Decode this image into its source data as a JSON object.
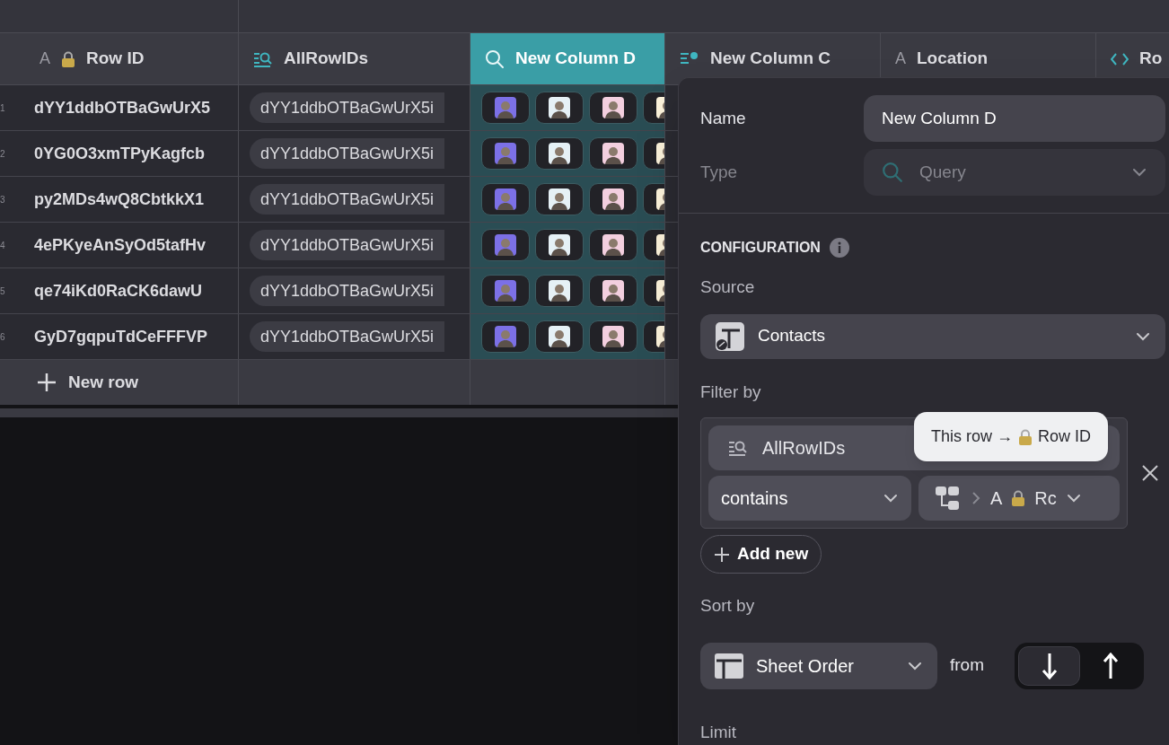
{
  "columns": [
    {
      "icon_text": "A",
      "locked": true,
      "label": "Row ID",
      "kind": "text",
      "selected": false
    },
    {
      "locked": false,
      "label": "AllRowIDs",
      "kind": "query-list",
      "selected": false
    },
    {
      "locked": false,
      "label": "New Column D",
      "kind": "query",
      "selected": true
    },
    {
      "locked": false,
      "label": "New Column C",
      "kind": "person-list",
      "selected": false
    },
    {
      "icon_text": "A",
      "locked": false,
      "label": "Location",
      "kind": "text",
      "selected": false
    },
    {
      "locked": false,
      "label": "Ro",
      "kind": "code",
      "selected": false
    }
  ],
  "rows": [
    {
      "number": "1",
      "row_id": "dYY1ddbOTBaGwUrX5",
      "all_row_ids": "dYY1ddbOTBaGwUrX5i",
      "avatars": [
        {
          "color": "#7c70e6"
        },
        {
          "color": "#e6f1f6"
        },
        {
          "color": "#f3cfdf"
        },
        {
          "color": "#fbf2da"
        }
      ]
    },
    {
      "number": "2",
      "row_id": "0YG0O3xmTPyKagfcb",
      "all_row_ids": "dYY1ddbOTBaGwUrX5i",
      "avatars": [
        {
          "color": "#7c70e6"
        },
        {
          "color": "#e6f1f6"
        },
        {
          "color": "#f3cfdf"
        },
        {
          "color": "#fbf2da"
        }
      ]
    },
    {
      "number": "3",
      "row_id": "py2MDs4wQ8CbtkkX1",
      "all_row_ids": "dYY1ddbOTBaGwUrX5i",
      "avatars": [
        {
          "color": "#7c70e6"
        },
        {
          "color": "#e6f1f6"
        },
        {
          "color": "#f3cfdf"
        },
        {
          "color": "#fbf2da"
        }
      ]
    },
    {
      "number": "4",
      "row_id": "4ePKyeAnSyOd5tafHv",
      "all_row_ids": "dYY1ddbOTBaGwUrX5i",
      "avatars": [
        {
          "color": "#7c70e6"
        },
        {
          "color": "#e6f1f6"
        },
        {
          "color": "#f3cfdf"
        },
        {
          "color": "#fbf2da"
        }
      ]
    },
    {
      "number": "5",
      "row_id": "qe74iKd0RaCK6dawU",
      "all_row_ids": "dYY1ddbOTBaGwUrX5i",
      "avatars": [
        {
          "color": "#7c70e6"
        },
        {
          "color": "#e6f1f6"
        },
        {
          "color": "#f3cfdf"
        },
        {
          "color": "#fbf2da"
        }
      ]
    },
    {
      "number": "6",
      "row_id": "GyD7gqpuTdCeFFFVP",
      "all_row_ids": "dYY1ddbOTBaGwUrX5i",
      "avatars": [
        {
          "color": "#7c70e6"
        },
        {
          "color": "#e6f1f6"
        },
        {
          "color": "#f3cfdf"
        },
        {
          "color": "#fbf2da"
        }
      ]
    }
  ],
  "new_row": "New row",
  "panel": {
    "name_label": "Name",
    "name_value": "New Column D",
    "type_label": "Type",
    "type_value": "Query",
    "type_disabled": true,
    "section_title": "CONFIGURATION",
    "source_label": "Source",
    "source_value": "Contacts",
    "filter_label": "Filter by",
    "filter": {
      "column": "AllRowIDs",
      "operator": "contains",
      "value_type_text": "A",
      "value_label": "Rc"
    },
    "tooltip": {
      "before": "This row →",
      "after": "Row ID"
    },
    "add_button": "Add new",
    "sort_label": "Sort by",
    "sort_value": "Sheet Order",
    "from_label": "from",
    "directions": [
      {
        "kind": "descending",
        "selected": true
      },
      {
        "kind": "ascending",
        "selected": false
      }
    ],
    "limit_label": "Limit"
  }
}
